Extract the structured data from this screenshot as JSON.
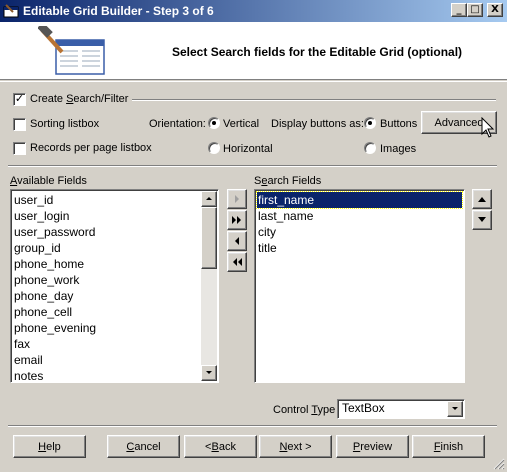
{
  "window": {
    "title": "Editable Grid Builder - Step 3 of 6",
    "controls": {
      "minimize": "_",
      "maximize": "□",
      "close": "X"
    }
  },
  "header": {
    "subtitle": "Select Search fields for the Editable Grid (optional)",
    "icon": "grid-builder-hammer-icon"
  },
  "options": {
    "create_search_filter": {
      "pre": "Create ",
      "accel": "S",
      "post": "earch/Filter",
      "checked": true
    },
    "sorting_listbox": {
      "label": "Sorting listbox",
      "checked": false
    },
    "records_per_page": {
      "label": "Records per page listbox",
      "checked": false
    },
    "orientation_label": "Orientation:",
    "orientation_vertical": {
      "label": "Vertical",
      "selected": true
    },
    "orientation_horizontal": {
      "label": "Horizontal",
      "selected": false
    },
    "display_buttons_label": "Display buttons as:",
    "display_buttons": {
      "label": "Buttons",
      "selected": true
    },
    "display_images": {
      "label": "Images",
      "selected": false
    },
    "advanced_button": "Advanced"
  },
  "available_fields": {
    "label_accel": "A",
    "label_rest": "vailable Fields",
    "items": [
      "user_id",
      "user_login",
      "user_password",
      "group_id",
      "phone_home",
      "phone_work",
      "phone_day",
      "phone_cell",
      "phone_evening",
      "fax",
      "email",
      "notes"
    ]
  },
  "search_fields": {
    "label_pre": "S",
    "label_accel": "e",
    "label_rest": "arch Fields",
    "items": [
      "first_name",
      "last_name",
      "city",
      "title"
    ],
    "selected_index": 0
  },
  "transfer_buttons": [
    "add-one-icon",
    "add-all-icon",
    "remove-one-icon",
    "remove-all-icon"
  ],
  "control_type": {
    "label_pre": "Control ",
    "label_accel": "T",
    "label_rest": "ype",
    "value": "TextBox"
  },
  "footer": {
    "help": {
      "accel": "H",
      "rest": "elp"
    },
    "cancel": {
      "accel": "C",
      "rest": "ancel"
    },
    "back": {
      "pre": "< ",
      "accel": "B",
      "rest": "ack"
    },
    "next": {
      "accel": "N",
      "rest": "ext >"
    },
    "preview": {
      "accel": "P",
      "rest": "review"
    },
    "finish": {
      "accel": "F",
      "rest": "inish"
    }
  }
}
